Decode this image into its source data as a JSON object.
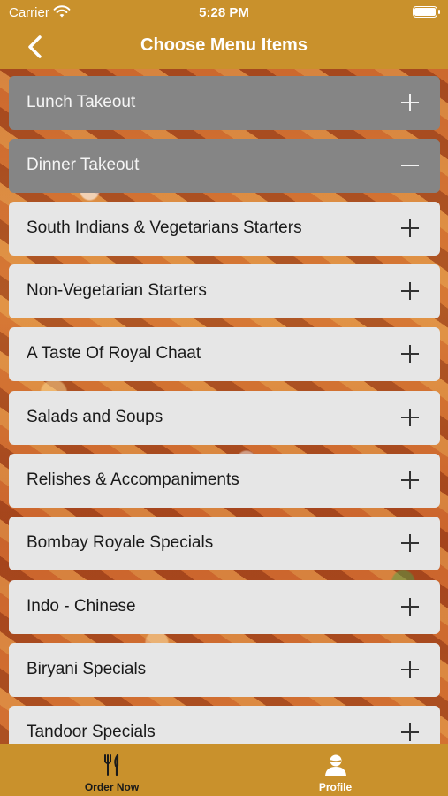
{
  "status_bar": {
    "carrier": "Carrier",
    "time": "5:28 PM"
  },
  "nav": {
    "title": "Choose Menu Items",
    "back_icon": "chevron-left-icon"
  },
  "menu": {
    "items": [
      {
        "label": "Lunch Takeout",
        "expanded": false,
        "style": "category"
      },
      {
        "label": "Dinner Takeout",
        "expanded": true,
        "style": "category"
      },
      {
        "label": "South Indians & Vegetarians Starters",
        "expanded": false,
        "style": "item"
      },
      {
        "label": "Non-Vegetarian Starters",
        "expanded": false,
        "style": "item"
      },
      {
        "label": "A Taste Of Royal Chaat",
        "expanded": false,
        "style": "item"
      },
      {
        "label": "Salads and Soups",
        "expanded": false,
        "style": "item"
      },
      {
        "label": "Relishes & Accompaniments",
        "expanded": false,
        "style": "item"
      },
      {
        "label": "Bombay Royale Specials",
        "expanded": false,
        "style": "item"
      },
      {
        "label": "Indo - Chinese",
        "expanded": false,
        "style": "item"
      },
      {
        "label": "Biryani Specials",
        "expanded": false,
        "style": "item"
      },
      {
        "label": "Tandoor Specials",
        "expanded": false,
        "style": "item"
      }
    ]
  },
  "tabs": [
    {
      "label": "Order Now",
      "icon": "fork-knife-icon",
      "selected": false
    },
    {
      "label": "Profile",
      "icon": "person-icon",
      "selected": true
    }
  ],
  "colors": {
    "bar": "#c9912c",
    "category_row": "#858585",
    "item_row": "#e6e6e6"
  }
}
